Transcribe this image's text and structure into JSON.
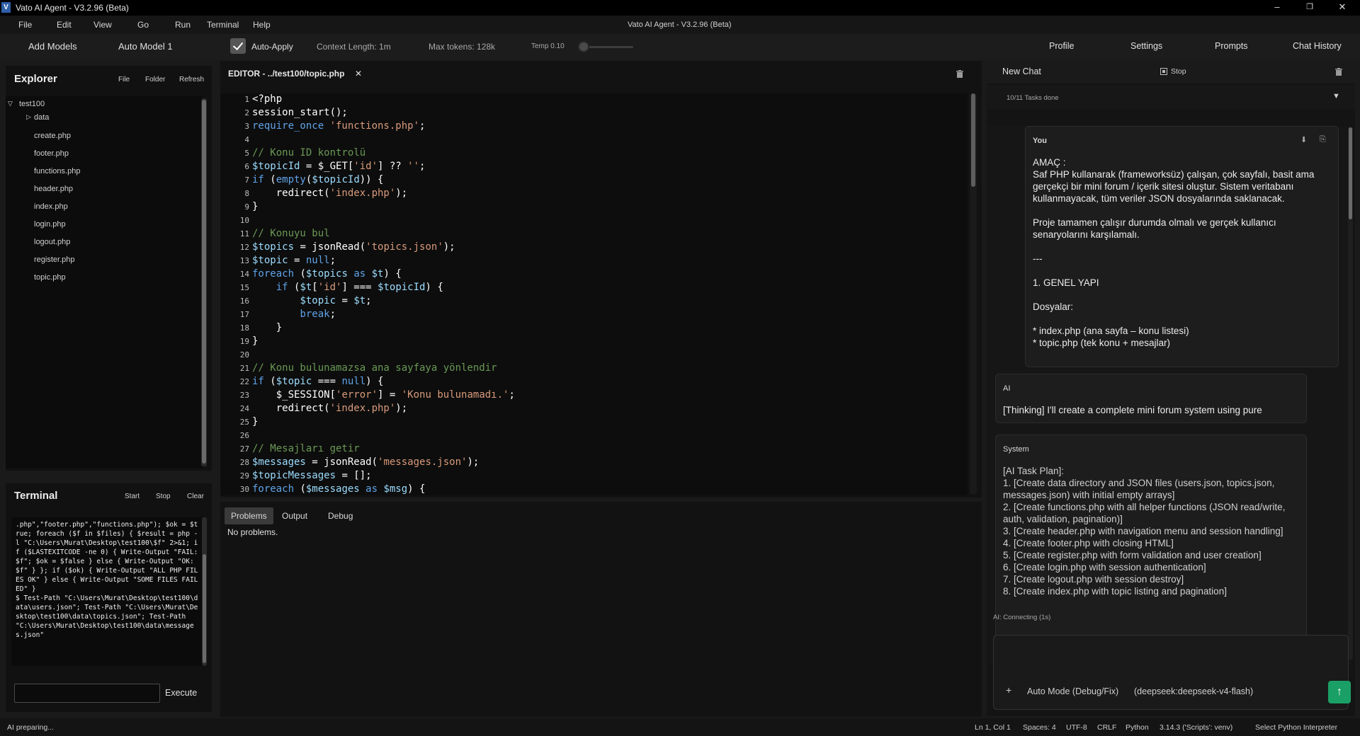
{
  "window": {
    "title": "Vato AI Agent - V3.2.96 (Beta)",
    "center_title": "Vato AI Agent - V3.2.96 (Beta)",
    "app_icon_letter": "V",
    "controls": {
      "minimize": "–",
      "maximize": "❐",
      "close": "✕"
    }
  },
  "menu": [
    "File",
    "Edit",
    "View",
    "Go",
    "Run",
    "Terminal",
    "Help"
  ],
  "toolbar": {
    "add_models": "Add Models",
    "model": "Auto Model 1",
    "auto_apply_label": "Auto-Apply",
    "auto_apply_checked": true,
    "context_length": "Context Length: 1m",
    "max_tokens": "Max tokens: 128k",
    "temp": "Temp 0.10",
    "temp_value": 0.1,
    "profile": "Profile",
    "settings": "Settings",
    "prompts": "Prompts",
    "chat_history": "Chat History"
  },
  "explorer": {
    "title": "Explorer",
    "buttons": [
      "File",
      "Folder",
      "Refresh"
    ],
    "root": "test100",
    "folder": "data",
    "files": [
      "create.php",
      "footer.php",
      "functions.php",
      "header.php",
      "index.php",
      "login.php",
      "logout.php",
      "register.php",
      "topic.php"
    ]
  },
  "terminal": {
    "title": "Terminal",
    "buttons": [
      "Start",
      "Stop",
      "Clear"
    ],
    "output": ".php\",\"footer.php\",\"functions.php\"); $ok = $true; foreach ($f in $files) { $result = php -l \"C:\\Users\\Murat\\Desktop\\test100\\$f\" 2>&1; if ($LASTEXITCODE -ne 0) { Write-Output \"FAIL: $f\"; $ok = $false } else { Write-Output \"OK: $f\" } }; if ($ok) { Write-Output \"ALL PHP FILES OK\" } else { Write-Output \"SOME FILES FAILED\" }\n$ Test-Path \"C:\\Users\\Murat\\Desktop\\test100\\data\\users.json\"; Test-Path \"C:\\Users\\Murat\\Desktop\\test100\\data\\topics.json\"; Test-Path \"C:\\Users\\Murat\\Desktop\\test100\\data\\messages.json\"",
    "input_value": "",
    "execute": "Execute"
  },
  "editor": {
    "tab_label": "EDITOR - ../test100/topic.php",
    "close_glyph": "✕",
    "lines": [
      {
        "n": "1",
        "segs": [
          [
            "",
            "<?php"
          ]
        ]
      },
      {
        "n": "2",
        "segs": [
          [
            "",
            "session_start();"
          ]
        ]
      },
      {
        "n": "3",
        "segs": [
          [
            "kw",
            "require_once "
          ],
          [
            "str",
            "'functions.php'"
          ],
          [
            "",
            ";"
          ]
        ]
      },
      {
        "n": "4",
        "segs": [
          [
            "",
            ""
          ]
        ]
      },
      {
        "n": "5",
        "segs": [
          [
            "cm",
            "// Konu ID kontrolü"
          ]
        ]
      },
      {
        "n": "6",
        "segs": [
          [
            "va",
            "$topicId"
          ],
          [
            "",
            " = $_GET["
          ],
          [
            "str",
            "'id'"
          ],
          [
            "",
            "] ?? "
          ],
          [
            "str",
            "''"
          ],
          [
            "",
            ";"
          ]
        ]
      },
      {
        "n": "7",
        "segs": [
          [
            "kw",
            "if"
          ],
          [
            "",
            " ("
          ],
          [
            "kw",
            "empty"
          ],
          [
            "",
            "("
          ],
          [
            "va",
            "$topicId"
          ],
          [
            "",
            ")) {"
          ]
        ]
      },
      {
        "n": "8",
        "segs": [
          [
            "",
            "    redirect("
          ],
          [
            "str",
            "'index.php'"
          ],
          [
            "",
            ");"
          ]
        ]
      },
      {
        "n": "9",
        "segs": [
          [
            "",
            "}"
          ]
        ]
      },
      {
        "n": "10",
        "segs": [
          [
            "",
            ""
          ]
        ]
      },
      {
        "n": "11",
        "segs": [
          [
            "cm",
            "// Konuyu bul"
          ]
        ]
      },
      {
        "n": "12",
        "segs": [
          [
            "va",
            "$topics"
          ],
          [
            "",
            " = jsonRead("
          ],
          [
            "str",
            "'topics.json'"
          ],
          [
            "",
            ");"
          ]
        ]
      },
      {
        "n": "13",
        "segs": [
          [
            "va",
            "$topic"
          ],
          [
            "",
            " = "
          ],
          [
            "kw",
            "null"
          ],
          [
            "",
            ";"
          ]
        ]
      },
      {
        "n": "14",
        "segs": [
          [
            "kw",
            "foreach"
          ],
          [
            "",
            " ("
          ],
          [
            "va",
            "$topics"
          ],
          [
            "kw",
            " as "
          ],
          [
            "va",
            "$t"
          ],
          [
            "",
            ") {"
          ]
        ]
      },
      {
        "n": "15",
        "segs": [
          [
            "",
            "    "
          ],
          [
            "kw",
            "if"
          ],
          [
            "",
            " ("
          ],
          [
            "va",
            "$t"
          ],
          [
            "",
            "["
          ],
          [
            "str",
            "'id'"
          ],
          [
            "",
            "] === "
          ],
          [
            "va",
            "$topicId"
          ],
          [
            "",
            ") {"
          ]
        ]
      },
      {
        "n": "16",
        "segs": [
          [
            "",
            "        "
          ],
          [
            "va",
            "$topic"
          ],
          [
            "",
            " = "
          ],
          [
            "va",
            "$t"
          ],
          [
            "",
            ";"
          ]
        ]
      },
      {
        "n": "17",
        "segs": [
          [
            "",
            "        "
          ],
          [
            "kw",
            "break"
          ],
          [
            "",
            ";"
          ]
        ]
      },
      {
        "n": "18",
        "segs": [
          [
            "",
            "    }"
          ]
        ]
      },
      {
        "n": "19",
        "segs": [
          [
            "",
            "}"
          ]
        ]
      },
      {
        "n": "20",
        "segs": [
          [
            "",
            ""
          ]
        ]
      },
      {
        "n": "21",
        "segs": [
          [
            "cm",
            "// Konu bulunamazsa ana sayfaya yönlendir"
          ]
        ]
      },
      {
        "n": "22",
        "segs": [
          [
            "kw",
            "if"
          ],
          [
            "",
            " ("
          ],
          [
            "va",
            "$topic"
          ],
          [
            "",
            " === "
          ],
          [
            "kw",
            "null"
          ],
          [
            "",
            ") {"
          ]
        ]
      },
      {
        "n": "23",
        "segs": [
          [
            "",
            "    $_SESSION["
          ],
          [
            "str",
            "'error'"
          ],
          [
            "",
            "] = "
          ],
          [
            "str",
            "'Konu bulunamadı.'"
          ],
          [
            "",
            ";"
          ]
        ]
      },
      {
        "n": "24",
        "segs": [
          [
            "",
            "    redirect("
          ],
          [
            "str",
            "'index.php'"
          ],
          [
            "",
            ");"
          ]
        ]
      },
      {
        "n": "25",
        "segs": [
          [
            "",
            "}"
          ]
        ]
      },
      {
        "n": "26",
        "segs": [
          [
            "",
            ""
          ]
        ]
      },
      {
        "n": "27",
        "segs": [
          [
            "cm",
            "// Mesajları getir"
          ]
        ]
      },
      {
        "n": "28",
        "segs": [
          [
            "va",
            "$messages"
          ],
          [
            "",
            " = jsonRead("
          ],
          [
            "str",
            "'messages.json'"
          ],
          [
            "",
            ");"
          ]
        ]
      },
      {
        "n": "29",
        "segs": [
          [
            "va",
            "$topicMessages"
          ],
          [
            "",
            " = [];"
          ]
        ]
      },
      {
        "n": "30",
        "segs": [
          [
            "kw",
            "foreach"
          ],
          [
            "",
            " ("
          ],
          [
            "va",
            "$messages"
          ],
          [
            "kw",
            " as "
          ],
          [
            "va",
            "$msg"
          ],
          [
            "",
            ") {"
          ]
        ]
      }
    ]
  },
  "bottom_panel": {
    "tabs": [
      "Problems",
      "Output",
      "Debug"
    ],
    "active_tab": "Problems",
    "message": "No problems."
  },
  "chat": {
    "new_chat": "New Chat",
    "stop": "Stop",
    "tasks_done": "10/11 Tasks done",
    "messages": [
      {
        "who": "You",
        "text": "AMAÇ :\nSaf PHP kullanarak (frameworksüz) çalışan, çok sayfalı, basit ama gerçekçi bir mini forum / içerik sitesi oluştur. Sistem veritabanı kullanmayacak, tüm veriler JSON dosyalarında saklanacak.\n\nProje tamamen çalışır durumda olmalı ve gerçek kullanıcı senaryolarını karşılamalı.\n\n---\n\n1. GENEL YAPI\n\nDosyalar:\n\n* index.php (ana sayfa – konu listesi)\n* topic.php (tek konu + mesajlar)"
      },
      {
        "who": "AI",
        "text": "[Thinking] I'll create a complete mini forum system using pure"
      },
      {
        "who": "System",
        "text": "[AI Task Plan]:\n1. [Create data directory and JSON files (users.json, topics.json, messages.json) with initial empty arrays]\n2. [Create functions.php with all helper functions (JSON read/write, auth, validation, pagination)]\n3. [Create header.php with navigation menu and session handling]\n4. [Create footer.php with closing HTML]\n5. [Create register.php with form validation and user creation]\n6. [Create login.php with session authentication]\n7. [Create logout.php with session destroy]\n8. [Create index.php with topic listing and pagination]"
      }
    ],
    "status": "AI: Connecting (1s)",
    "input_placeholder": "",
    "mode": "Auto Mode (Debug/Fix)",
    "model": "(deepseek:deepseek-v4-flash)",
    "send_glyph": "↑",
    "plus_glyph": "+",
    "accent": "#1aa066"
  },
  "statusbar": {
    "left": "AI preparing...",
    "position": "Ln 1, Col 1",
    "spaces": "Spaces: 4",
    "encoding": "UTF-8",
    "eol": "CRLF",
    "language": "Python",
    "interpreter": "3.14.3 ('Scripts': venv)",
    "select_interpreter": "Select Python Interpreter"
  }
}
